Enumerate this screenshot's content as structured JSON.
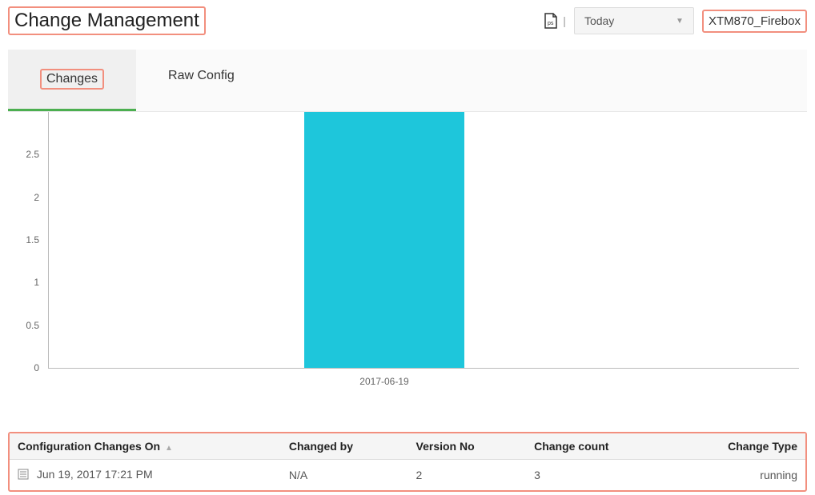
{
  "header": {
    "title": "Change Management",
    "date_filter": "Today",
    "device": "XTM870_Firebox"
  },
  "tabs": [
    {
      "label": "Changes",
      "active": true
    },
    {
      "label": "Raw Config",
      "active": false
    }
  ],
  "chart_data": {
    "type": "bar",
    "categories": [
      "2017-06-19"
    ],
    "values": [
      3
    ],
    "ylim": [
      0,
      3
    ],
    "yticks": [
      0,
      0.5,
      1,
      1.5,
      2,
      2.5
    ]
  },
  "table": {
    "columns": [
      "Configuration Changes On",
      "Changed by",
      "Version No",
      "Change count",
      "Change Type"
    ],
    "rows": [
      {
        "date": "Jun 19, 2017 17:21 PM",
        "changed_by": "N/A",
        "version": "2",
        "count": "3",
        "type": "running"
      }
    ]
  }
}
